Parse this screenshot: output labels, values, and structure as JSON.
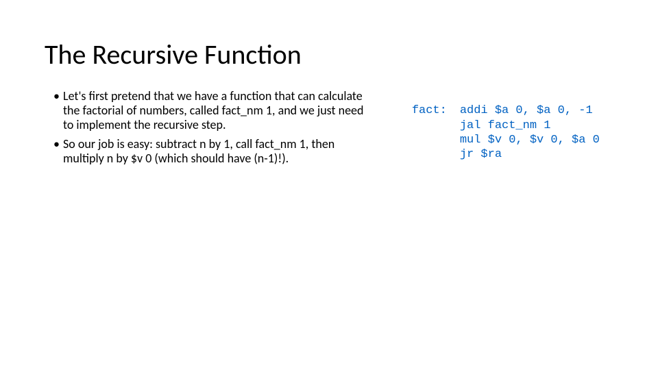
{
  "title": "The Recursive Function",
  "bullets": [
    "Let's first pretend that we have a function that can calculate the factorial of numbers, called fact_nm 1, and we just need to implement the recursive step.",
    "So our job is easy: subtract n by 1, call fact_nm 1, then multiply n by $v 0 (which should have (n-1)!)."
  ],
  "code": {
    "label": "fact:",
    "lines": "addi $a 0, $a 0, -1\njal fact_nm 1\nmul $v 0, $v 0, $a 0\njr $ra"
  }
}
